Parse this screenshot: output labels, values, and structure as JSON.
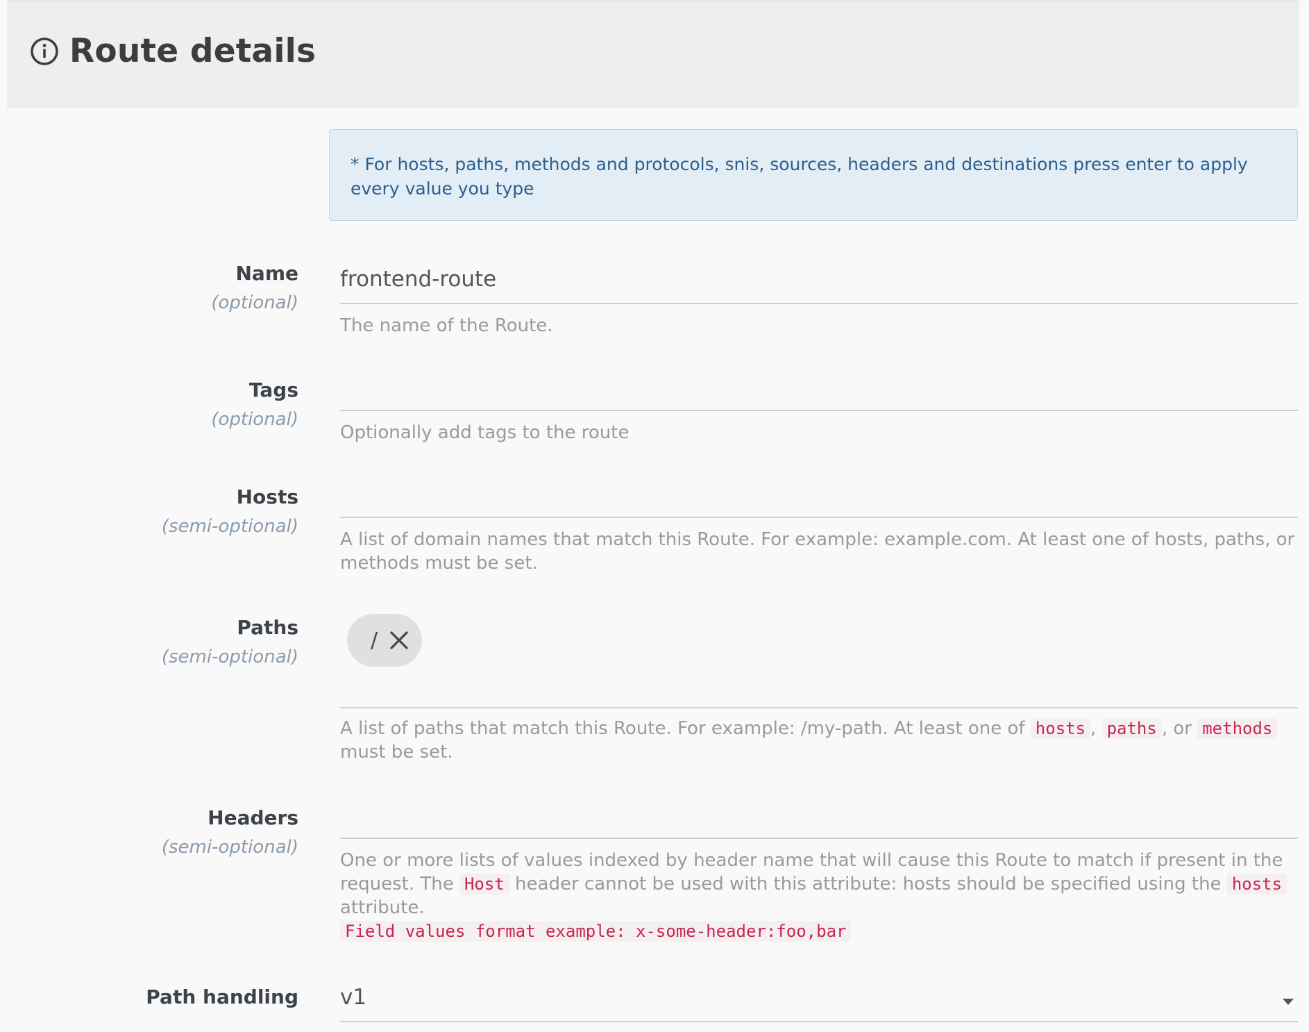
{
  "header": {
    "title": "Route details",
    "icon": "info-icon"
  },
  "notice": {
    "text": "* For hosts, paths, methods and protocols, snis, sources, headers and destinations press enter to apply every value you type"
  },
  "fields": {
    "name": {
      "label": "Name",
      "optional": "(optional)",
      "value": "frontend-route",
      "help": "The name of the Route."
    },
    "tags": {
      "label": "Tags",
      "optional": "(optional)",
      "value": "",
      "help": "Optionally add tags to the route"
    },
    "hosts": {
      "label": "Hosts",
      "optional": "(semi-optional)",
      "value": "",
      "help": "A list of domain names that match this Route. For example: example.com. At least one of hosts, paths, or methods must be set."
    },
    "paths": {
      "label": "Paths",
      "optional": "(semi-optional)",
      "chip": "/",
      "help_pre": "A list of paths that match this Route. For example: /my-path. At least one of ",
      "code1": "hosts",
      "sep1": ", ",
      "code2": "paths",
      "sep2": ", or ",
      "code3": "methods",
      "help_post": " must be set."
    },
    "headers": {
      "label": "Headers",
      "optional": "(semi-optional)",
      "help_pre": "One or more lists of values indexed by header name that will cause this Route to match if present in the request. The ",
      "code1": "Host",
      "help_mid": " header cannot be used with this attribute: hosts should be specified using the ",
      "code2": "hosts",
      "help_post": " attribute.",
      "example": "Field values format example: x-some-header:foo,bar"
    },
    "path_handling": {
      "label": "Path handling",
      "value": "v1"
    }
  },
  "colors": {
    "notice_bg": "#e2edf6",
    "code_red": "#c7254e",
    "header_bg": "#eeeeee"
  }
}
